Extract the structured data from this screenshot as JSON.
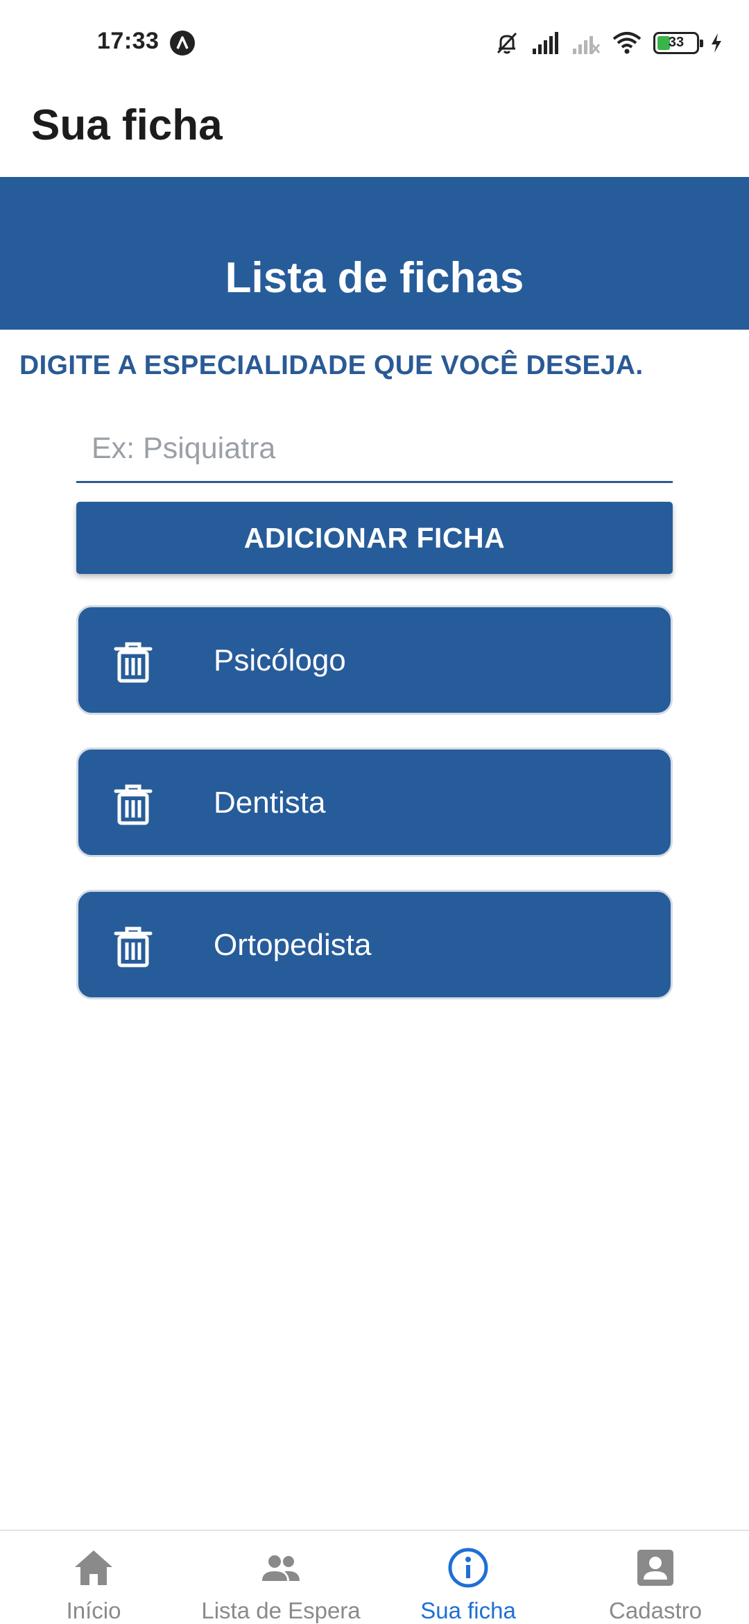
{
  "status_bar": {
    "time": "17:33",
    "battery_level": "33",
    "battery_fraction": 0.33
  },
  "header": {
    "title": "Sua ficha"
  },
  "banner": {
    "title": "Lista de fichas"
  },
  "form": {
    "instruction": "DIGITE A ESPECIALIDADE QUE VOCÊ DESEJA.",
    "input_placeholder": "Ex: Psiquiatra",
    "input_value": "",
    "add_button_label": "ADICIONAR FICHA"
  },
  "fichas": [
    {
      "label": "Psicólogo",
      "icon": "trash-icon"
    },
    {
      "label": "Dentista",
      "icon": "trash-icon"
    },
    {
      "label": "Ortopedista",
      "icon": "trash-icon"
    }
  ],
  "bottom_nav": {
    "items": [
      {
        "label": "Início",
        "icon": "home-icon",
        "active": false
      },
      {
        "label": "Lista de Espera",
        "icon": "people-icon",
        "active": false
      },
      {
        "label": "Sua ficha",
        "icon": "info-icon",
        "active": true
      },
      {
        "label": "Cadastro",
        "icon": "account-box-icon",
        "active": false
      }
    ]
  },
  "colors": {
    "primary": "#275c9a",
    "instruction_text": "#2a5a95",
    "nav_active": "#1e6fd6",
    "nav_inactive": "#8a8a8a",
    "battery": "#3cb34a"
  }
}
